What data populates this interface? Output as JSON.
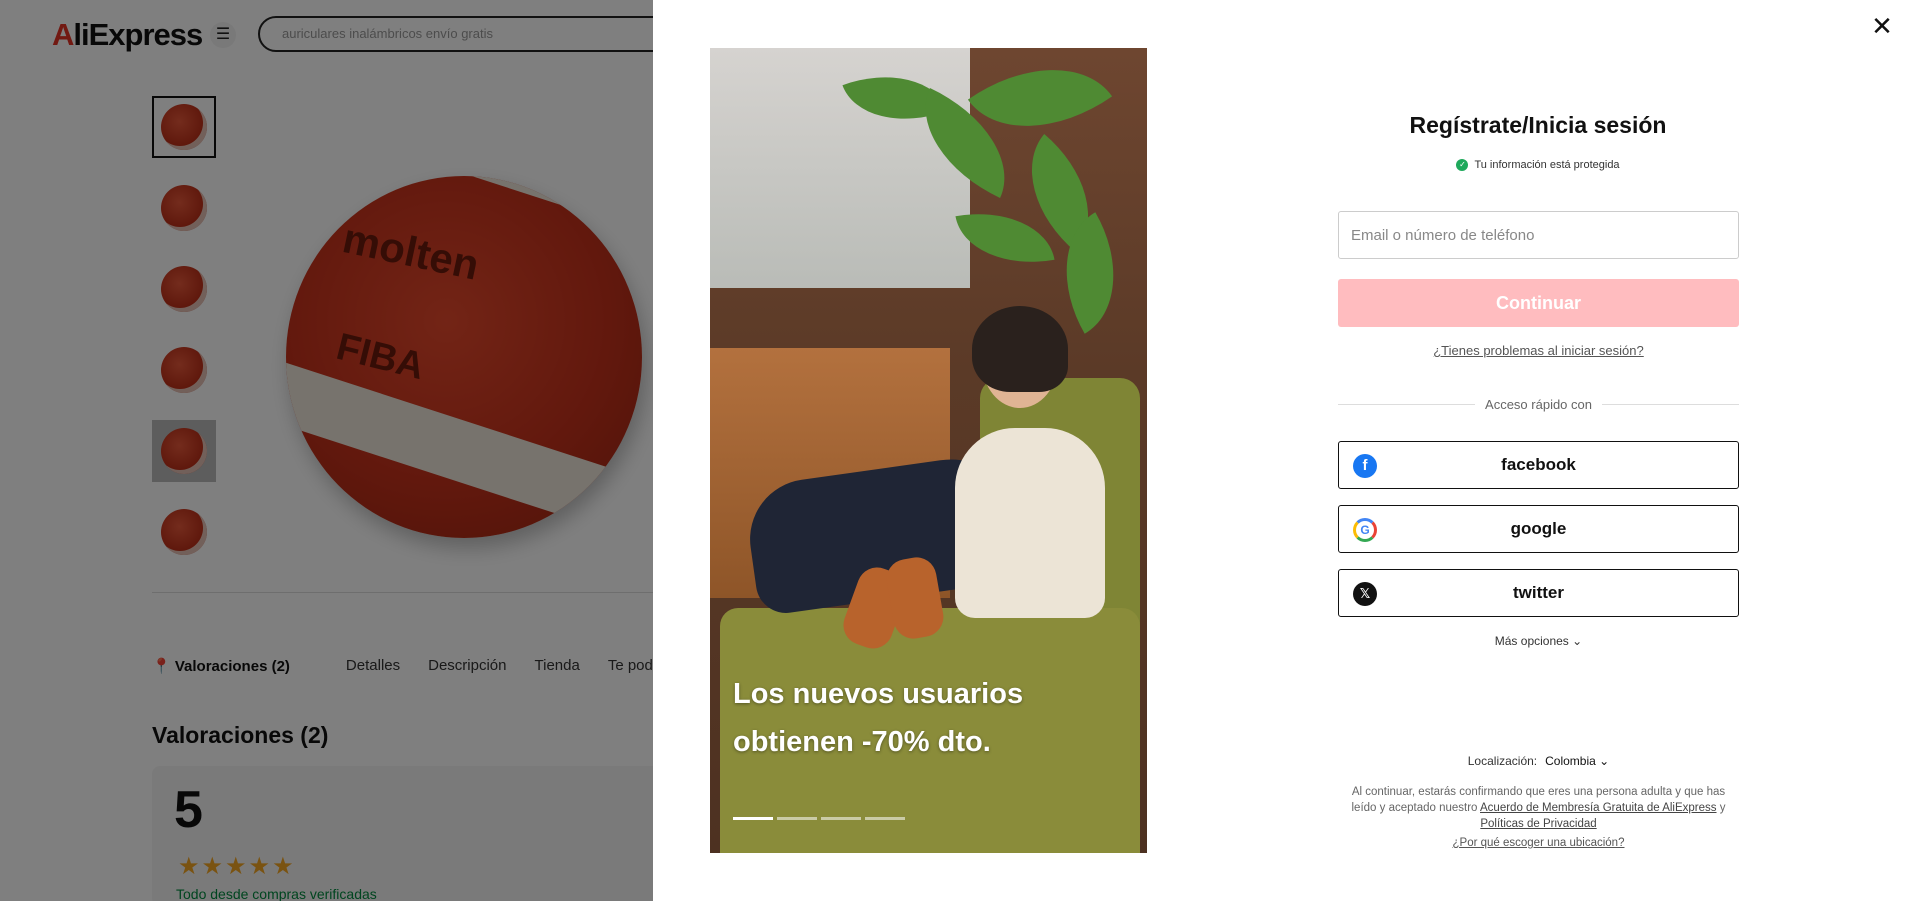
{
  "background": {
    "logo": "AliExpress",
    "search_value": "auriculares inalámbricos envío gratis",
    "tabs": [
      "Valoraciones (2)",
      "Detalles",
      "Descripción",
      "Tienda",
      "Te podría in"
    ],
    "reviews_title": "Valoraciones (2)",
    "rating": "5",
    "stars": "★★★★★",
    "verified_text": "Todo desde compras verificadas",
    "product_brand": "molten",
    "product_mark": "FIBA"
  },
  "promo": {
    "headline": "Los nuevos usuarios obtienen -70% dto.",
    "slide_count": 4,
    "active_slide": 1
  },
  "login": {
    "title": "Regístrate/Inicia sesión",
    "protected_text": "Tu información está protegida",
    "email_placeholder": "Email o número de teléfono",
    "continue_label": "Continuar",
    "trouble_link": "¿Tienes problemas al iniciar sesión?",
    "quick_access": "Acceso rápido con",
    "social": {
      "facebook": "facebook",
      "google": "google",
      "twitter": "twitter"
    },
    "more_options": "Más opciones",
    "locale_label": "Localización:",
    "locale_value": "Colombia",
    "legal_prefix": "Al continuar, estarás confirmando que eres una persona adulta y que has leído y aceptado nuestro",
    "legal_link1": "Acuerdo de Membresía Gratuita de AliExpress",
    "legal_and": "y",
    "legal_link2": "Políticas de Privacidad",
    "why_location": "¿Por qué escoger una ubicación?"
  },
  "icons": {
    "close": "close-icon",
    "shield": "shield-check-icon",
    "chevron": "chevron-down-icon"
  },
  "colors": {
    "continue_bg": "#ffbcbf",
    "protected_green": "#1fa95c",
    "facebook_blue": "#1877f2"
  }
}
